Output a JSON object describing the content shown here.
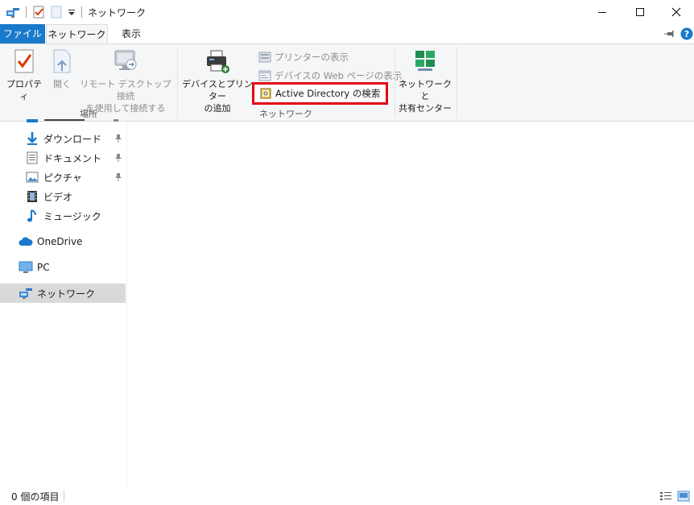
{
  "window": {
    "title": "ネットワーク"
  },
  "tabs": {
    "file": "ファイル",
    "network": "ネットワーク",
    "view": "表示"
  },
  "ribbon": {
    "location_group": {
      "label": "場所",
      "properties": "プロパティ",
      "open": "開く",
      "remote_desktop_line1": "リモート デスクトップ接続",
      "remote_desktop_line2": "を使用して接続する"
    },
    "network_group": {
      "label": "ネットワーク",
      "add_device_line1": "デバイスとプリンター",
      "add_device_line2": "の追加",
      "view_printers": "プリンターの表示",
      "view_device_web": "デバイスの Web ページの表示",
      "search_ad": "Active Directory の検索"
    },
    "network_center_line1": "ネットワークと",
    "network_center_line2": "共有センター"
  },
  "nav": {
    "items": [
      {
        "label": "ダウンロード"
      },
      {
        "label": "ドキュメント"
      },
      {
        "label": "ピクチャ"
      },
      {
        "label": "ビデオ"
      },
      {
        "label": "ミュージック"
      },
      {
        "label": "OneDrive"
      },
      {
        "label": "PC"
      },
      {
        "label": "ネットワーク"
      }
    ]
  },
  "status": {
    "item_count": "0 個の項目"
  },
  "colors": {
    "accent": "#1979ca",
    "highlight": "#e60012",
    "ribbon_bg": "#f5f6f7"
  }
}
